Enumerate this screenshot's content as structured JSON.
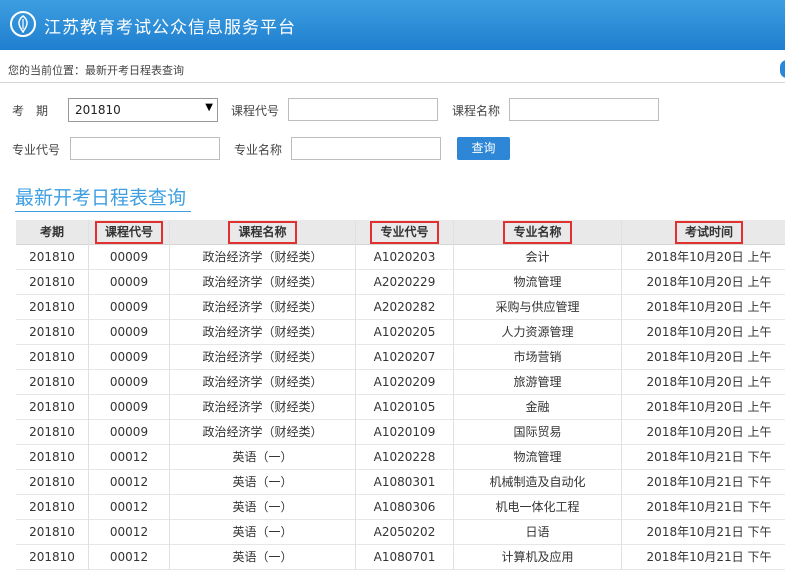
{
  "header": {
    "site_title": "江苏教育考试公众信息服务平台",
    "logo_icon": "exam-logo-icon"
  },
  "breadcrumb": "您的当前位置：最新开考日程表查询",
  "form": {
    "period_label": "考　期",
    "period_value": "201810",
    "course_code_label": "课程代号",
    "course_name_label": "课程名称",
    "major_code_label": "专业代号",
    "major_name_label": "专业名称",
    "search_button": "查询"
  },
  "page_title": "最新开考日程表查询",
  "table": {
    "headers": [
      "考期",
      "课程代号",
      "课程名称",
      "专业代号",
      "专业名称",
      "考试时间"
    ],
    "rows": [
      [
        "201810",
        "00009",
        "政治经济学（财经类）",
        "A1020203",
        "会计",
        "2018年10月20日 上午"
      ],
      [
        "201810",
        "00009",
        "政治经济学（财经类）",
        "A2020229",
        "物流管理",
        "2018年10月20日 上午"
      ],
      [
        "201810",
        "00009",
        "政治经济学（财经类）",
        "A2020282",
        "采购与供应管理",
        "2018年10月20日 上午"
      ],
      [
        "201810",
        "00009",
        "政治经济学（财经类）",
        "A1020205",
        "人力资源管理",
        "2018年10月20日 上午"
      ],
      [
        "201810",
        "00009",
        "政治经济学（财经类）",
        "A1020207",
        "市场营销",
        "2018年10月20日 上午"
      ],
      [
        "201810",
        "00009",
        "政治经济学（财经类）",
        "A1020209",
        "旅游管理",
        "2018年10月20日 上午"
      ],
      [
        "201810",
        "00009",
        "政治经济学（财经类）",
        "A1020105",
        "金融",
        "2018年10月20日 上午"
      ],
      [
        "201810",
        "00009",
        "政治经济学（财经类）",
        "A1020109",
        "国际贸易",
        "2018年10月20日 上午"
      ],
      [
        "201810",
        "00012",
        "英语（一）",
        "A1020228",
        "物流管理",
        "2018年10月21日 下午"
      ],
      [
        "201810",
        "00012",
        "英语（一）",
        "A1080301",
        "机械制造及自动化",
        "2018年10月21日 下午"
      ],
      [
        "201810",
        "00012",
        "英语（一）",
        "A1080306",
        "机电一体化工程",
        "2018年10月21日 下午"
      ],
      [
        "201810",
        "00012",
        "英语（一）",
        "A2050202",
        "日语",
        "2018年10月21日 下午"
      ],
      [
        "201810",
        "00012",
        "英语（一）",
        "A1080701",
        "计算机及应用",
        "2018年10月21日 下午"
      ]
    ]
  },
  "colors": {
    "header_blue": "#2a86d6",
    "title_blue": "#3e9fe2",
    "highlight_red": "#e03030"
  }
}
